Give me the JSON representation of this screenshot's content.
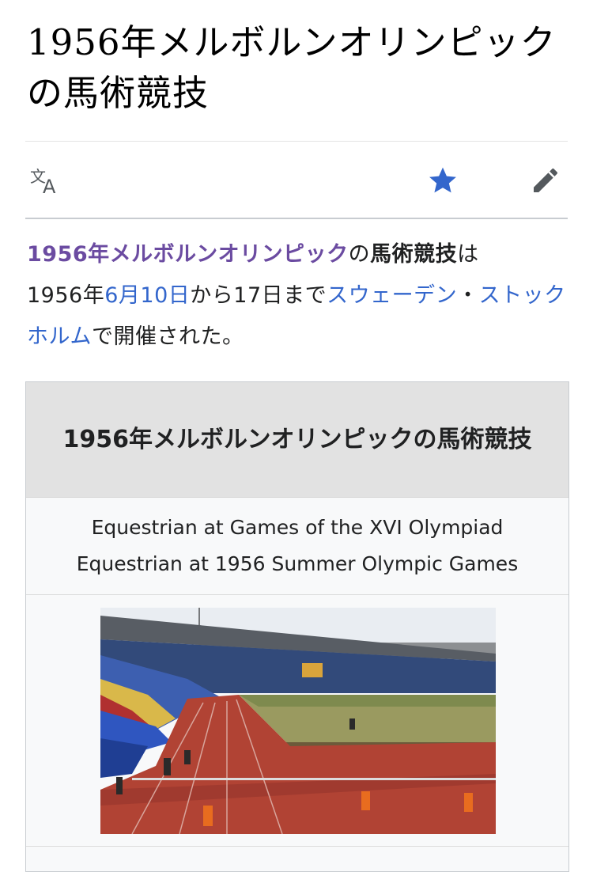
{
  "page": {
    "title": "1956年メルボルンオリンピックの馬術競技"
  },
  "toolbar": {
    "language_icon": "language-icon",
    "watch_icon": "star-icon",
    "edit_icon": "pencil-icon",
    "accent_color": "#3366cc"
  },
  "lead": {
    "link_olympics": "1956年メルボルンオリンピック",
    "text_no": "の",
    "bold_subject": "馬術競技",
    "text_wa": "は",
    "text_year": "1956年",
    "link_date": "6月10日",
    "text_until": "から17日まで",
    "link_sweden": "スウェーデン",
    "text_dot": "・",
    "link_stockholm": "ストックホルム",
    "text_end": "で開催された。"
  },
  "infobox": {
    "title": "1956年メルボルンオリンピックの馬術競技",
    "subtitle_1": "Equestrian at Games of the XVI Olympiad",
    "subtitle_2": "Equestrian at 1956 Summer Olympic Games"
  }
}
